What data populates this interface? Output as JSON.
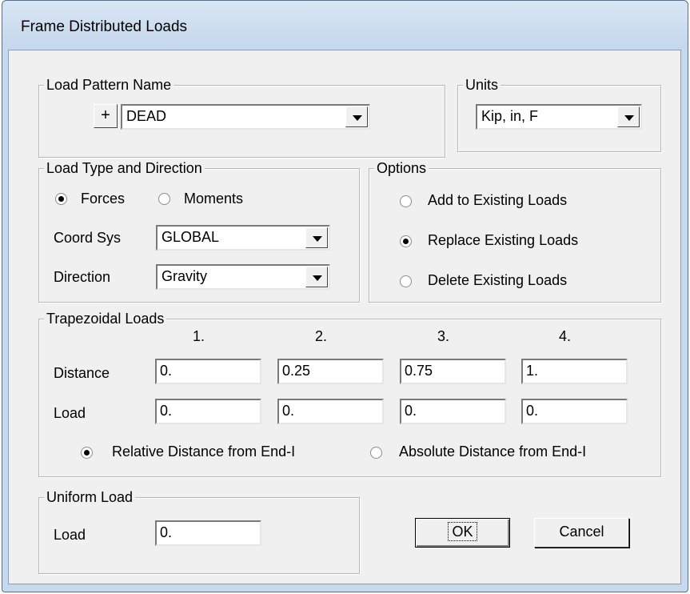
{
  "window": {
    "title": "Frame Distributed Loads"
  },
  "load_pattern": {
    "legend": "Load Pattern Name",
    "add_button": "+",
    "selected": "DEAD"
  },
  "units": {
    "legend": "Units",
    "selected": "Kip, in, F"
  },
  "load_type": {
    "legend": "Load Type and Direction",
    "forces_label": "Forces",
    "moments_label": "Moments",
    "selected": "Forces",
    "coord_sys_label": "Coord Sys",
    "coord_sys_value": "GLOBAL",
    "direction_label": "Direction",
    "direction_value": "Gravity"
  },
  "options": {
    "legend": "Options",
    "items": [
      {
        "label": "Add to Existing Loads",
        "selected": false
      },
      {
        "label": "Replace Existing Loads",
        "selected": true
      },
      {
        "label": "Delete Existing Loads",
        "selected": false
      }
    ]
  },
  "trapezoidal": {
    "legend": "Trapezoidal Loads",
    "columns": [
      "1.",
      "2.",
      "3.",
      "4."
    ],
    "distance_label": "Distance",
    "distances": [
      "0.",
      "0.25",
      "0.75",
      "1."
    ],
    "load_label": "Load",
    "loads": [
      "0.",
      "0.",
      "0.",
      "0."
    ],
    "relative_label": "Relative Distance from End-I",
    "absolute_label": "Absolute Distance from End-I",
    "mode": "relative"
  },
  "uniform": {
    "legend": "Uniform Load",
    "load_label": "Load",
    "load_value": "0."
  },
  "buttons": {
    "ok": "OK",
    "cancel": "Cancel"
  }
}
